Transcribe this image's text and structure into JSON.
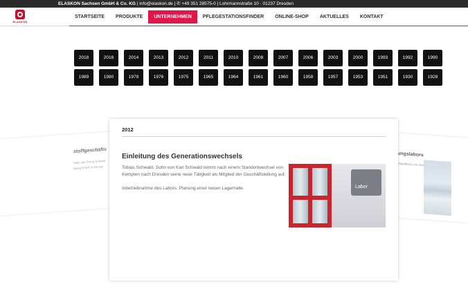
{
  "topbar": {
    "company": "ELASKON Sachsen GmbH & Co. KG",
    "email": "info@elaskon.de",
    "phone": "+49 351 28575-0",
    "address": "Lohrmannstraße 10 · 01237 Dresden"
  },
  "logo": {
    "text": "ELASKON"
  },
  "nav": {
    "items": [
      "STARTSEITE",
      "PRODUKTE",
      "UNTERNEHMEN",
      "PFLEGESTATIONSFINDER",
      "ONLINE-SHOP",
      "AKTUELLES",
      "KONTAKT"
    ],
    "active": "UNTERNEHMEN"
  },
  "years": [
    [
      "2018",
      "2016",
      "2014",
      "2013",
      "2012",
      "2011",
      "2010",
      "2008",
      "2007",
      "2006",
      "2003",
      "2000",
      "1993",
      "1992",
      "1990"
    ],
    [
      "1989",
      "1980",
      "1979",
      "1976",
      "1975",
      "1965",
      "1964",
      "1961",
      "1960",
      "1958",
      "1957",
      "1953",
      "1951",
      "1930",
      "1928"
    ]
  ],
  "main_card": {
    "year": "2012",
    "title": "Einleitung des Generationswechsels",
    "paragraphs": [
      "Tobias Schwald, Sohn von Karl Schwald nimmt nach einem Standortwechsel von Kempten nach Dresden seine neue Tätigkeit als Mitglied der Geschäftsleitung auf.",
      "Inbetriebnahme des Labors. Planung einer neuen Lagerhalle."
    ],
    "image_sign": "Labor"
  },
  "left_card": {
    "title": "stoffgeschäfts",
    "lines": [
      "häfts der Firma Schwal",
      "ldung Erfurt in die eig"
    ]
  },
  "right_card": {
    "title": "ungslabors",
    "lines": [
      "ungslabors mit einem"
    ]
  }
}
